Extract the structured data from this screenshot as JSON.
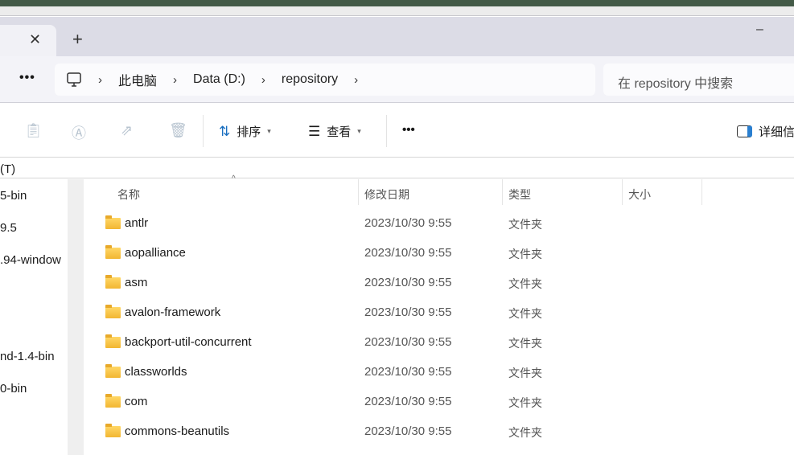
{
  "window": {
    "tab_close": "✕",
    "new_tab": "+",
    "minimize": "–"
  },
  "address": {
    "more": "•••",
    "crumbs": [
      "此电脑",
      "Data (D:)",
      "repository"
    ],
    "chevron": "›"
  },
  "search": {
    "placeholder": "在 repository 中搜索"
  },
  "toolbar": {
    "sort": "排序",
    "view": "查看",
    "more": "•••",
    "details": "详细信"
  },
  "sidebar": {
    "header": "(T)",
    "items": [
      "5-bin",
      "9.5",
      ".94-window",
      "nd-1.4-bin",
      "0-bin"
    ]
  },
  "list": {
    "columns": [
      "名称",
      "修改日期",
      "类型",
      "大小"
    ],
    "rows": [
      {
        "name": "antlr",
        "date": "2023/10/30 9:55",
        "type": "文件夹"
      },
      {
        "name": "aopalliance",
        "date": "2023/10/30 9:55",
        "type": "文件夹"
      },
      {
        "name": "asm",
        "date": "2023/10/30 9:55",
        "type": "文件夹"
      },
      {
        "name": "avalon-framework",
        "date": "2023/10/30 9:55",
        "type": "文件夹"
      },
      {
        "name": "backport-util-concurrent",
        "date": "2023/10/30 9:55",
        "type": "文件夹"
      },
      {
        "name": "classworlds",
        "date": "2023/10/30 9:55",
        "type": "文件夹"
      },
      {
        "name": "com",
        "date": "2023/10/30 9:55",
        "type": "文件夹"
      },
      {
        "name": "commons-beanutils",
        "date": "2023/10/30 9:55",
        "type": "文件夹"
      }
    ]
  }
}
